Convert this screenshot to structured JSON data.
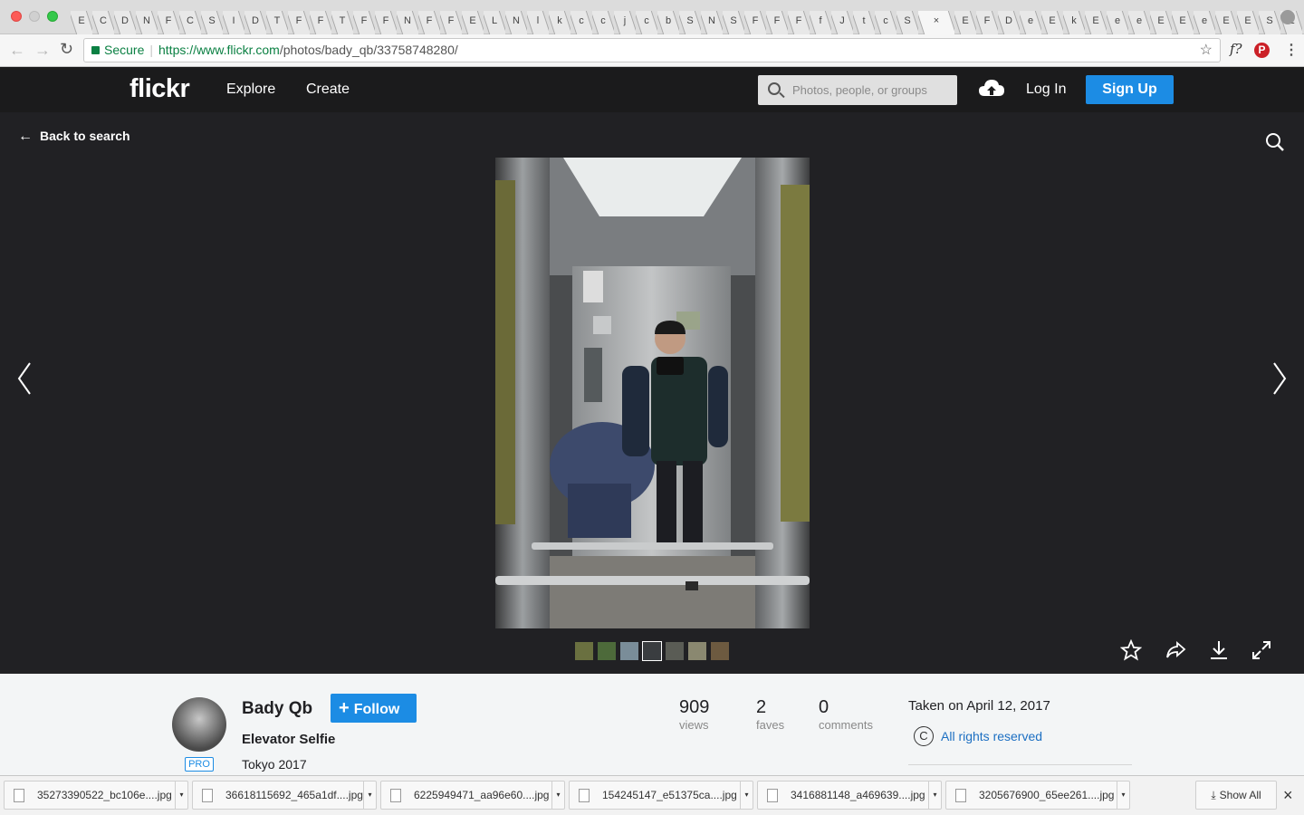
{
  "browser": {
    "tab_letters": [
      "E",
      "C",
      "D",
      "N",
      "F",
      "C",
      "S",
      "I",
      "D",
      "T",
      "F",
      "F",
      "T",
      "F",
      "F",
      "N",
      "F",
      "F",
      "E",
      "L",
      "N",
      "l",
      "k",
      "c",
      "c",
      "j",
      "c",
      "b",
      "S",
      "N",
      "S",
      "F",
      "F",
      "F",
      "f",
      "J",
      "t",
      "c",
      "S",
      "",
      "E",
      "F",
      "D",
      "e",
      "E",
      "k",
      "E",
      "e",
      "e",
      "E",
      "E",
      "e",
      "E",
      "E",
      "S",
      "E"
    ],
    "active_tab_close": "×",
    "secure_label": "Secure",
    "url_host": "https://www.flickr.com",
    "url_path": "/photos/bady_qb/33758748280/"
  },
  "nav": {
    "logo": "flickr",
    "explore": "Explore",
    "create": "Create",
    "search_placeholder": "Photos, people, or groups",
    "login": "Log In",
    "signup": "Sign Up"
  },
  "viewer": {
    "back_label": "Back to search"
  },
  "owner": {
    "name": "Bady Qb",
    "follow_label": "Follow",
    "pro_badge": "PRO",
    "photo_title": "Elevator Selfie",
    "description": "Tokyo 2017"
  },
  "stats": [
    {
      "value": "909",
      "label": "views"
    },
    {
      "value": "2",
      "label": "faves"
    },
    {
      "value": "0",
      "label": "comments"
    }
  ],
  "meta": {
    "taken": "Taken on April 12, 2017",
    "license_icon": "C",
    "license": "All rights reserved"
  },
  "downloads": {
    "items": [
      "35273390522_bc106e....jpg",
      "36618115692_465a1df....jpg",
      "6225949471_aa96e60....jpg",
      "154245147_e51375ca....jpg",
      "3416881148_a469639....jpg",
      "3205676900_65ee261....jpg"
    ],
    "show_all": "Show All",
    "close": "×"
  },
  "colors": {
    "accent": "#1c8ce4",
    "nav_bg": "#1b1b1c",
    "viewer_bg": "#212124"
  }
}
